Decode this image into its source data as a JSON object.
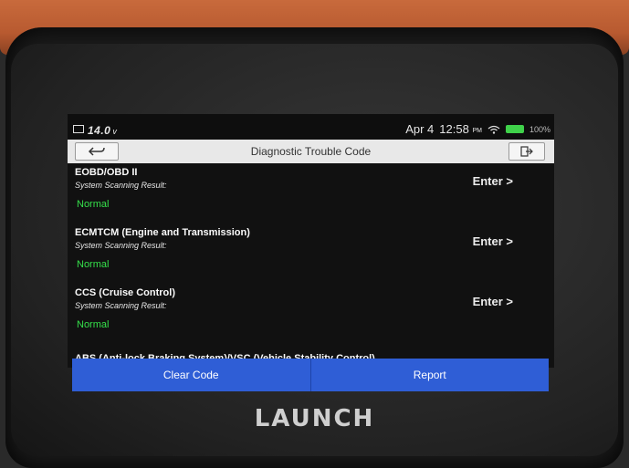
{
  "status": {
    "voltage": "14.0",
    "voltage_unit": "v",
    "date": "Apr 4",
    "time": "12:58",
    "ampm": "PM",
    "battery_pct": "100%"
  },
  "header": {
    "title": "Diagnostic Trouble Code"
  },
  "systems": [
    {
      "name": "EOBD/OBD II",
      "label": "System Scanning Result:",
      "result": "Normal",
      "action": "Enter >"
    },
    {
      "name": "ECMTCM (Engine and Transmission)",
      "label": "System Scanning Result:",
      "result": "Normal",
      "action": "Enter >"
    },
    {
      "name": "CCS (Cruise Control)",
      "label": "System Scanning Result:",
      "result": "Normal",
      "action": "Enter >"
    }
  ],
  "partial_row": "ABS (Anti-lock Braking System)/VSC (Vehicle Stability Control)",
  "footer": {
    "clear_label": "Clear Code",
    "report_label": "Report"
  },
  "brand": "LAUNCH",
  "colors": {
    "accent": "#2f5ed6",
    "normal_status": "#35e04a",
    "case_orange": "#c86a3c"
  }
}
